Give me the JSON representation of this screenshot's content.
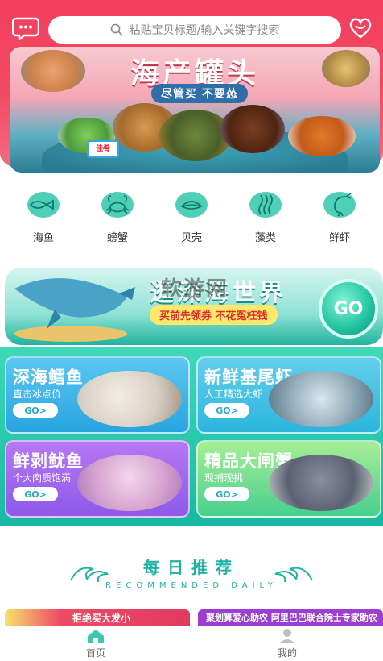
{
  "header": {
    "search_placeholder": "粘贴宝贝标题/输入关键字搜索",
    "left_icon": "message-icon",
    "right_icon": "customer-service-icon"
  },
  "hero": {
    "title": "海产罐头",
    "subtitle": "尽管买 不要怂",
    "can_label": "佳肴"
  },
  "categories": [
    {
      "label": "海鱼",
      "icon": "fish-icon"
    },
    {
      "label": "螃蟹",
      "icon": "crab-icon"
    },
    {
      "label": "贝壳",
      "icon": "shell-icon"
    },
    {
      "label": "藻类",
      "icon": "seaweed-icon"
    },
    {
      "label": "鲜虾",
      "icon": "shrimp-icon"
    }
  ],
  "promo": {
    "headline": "逛深海世界",
    "tagline": "买前先领券 不花冤枉钱",
    "go_label": "GO",
    "watermark": "软游网"
  },
  "products": [
    {
      "name": "深海鳕鱼",
      "desc": "直击冰点价",
      "go": "GO>"
    },
    {
      "name": "新鲜基尾虾",
      "desc": "人工精选大虾",
      "go": "GO>"
    },
    {
      "name": "鲜剥鱿鱼",
      "desc": "个大肉质饱满",
      "go": "GO>"
    },
    {
      "name": "精品大闸蟹",
      "desc": "现捕现挑",
      "go": "GO>"
    }
  ],
  "daily": {
    "title": "每日推荐",
    "subtitle": "RECOMMENDED DAILY"
  },
  "strips": {
    "left": "拒绝买大发小",
    "right": "聚划算爱心助农  阿里巴巴联合院士专家助农"
  },
  "nav": [
    {
      "label": "首页",
      "icon": "home-icon",
      "active": true
    },
    {
      "label": "我的",
      "icon": "profile-icon",
      "active": false
    }
  ],
  "colors": {
    "header_red": "#f43e5e",
    "teal": "#1fb3a3",
    "search_text": "#8c8c8c"
  }
}
